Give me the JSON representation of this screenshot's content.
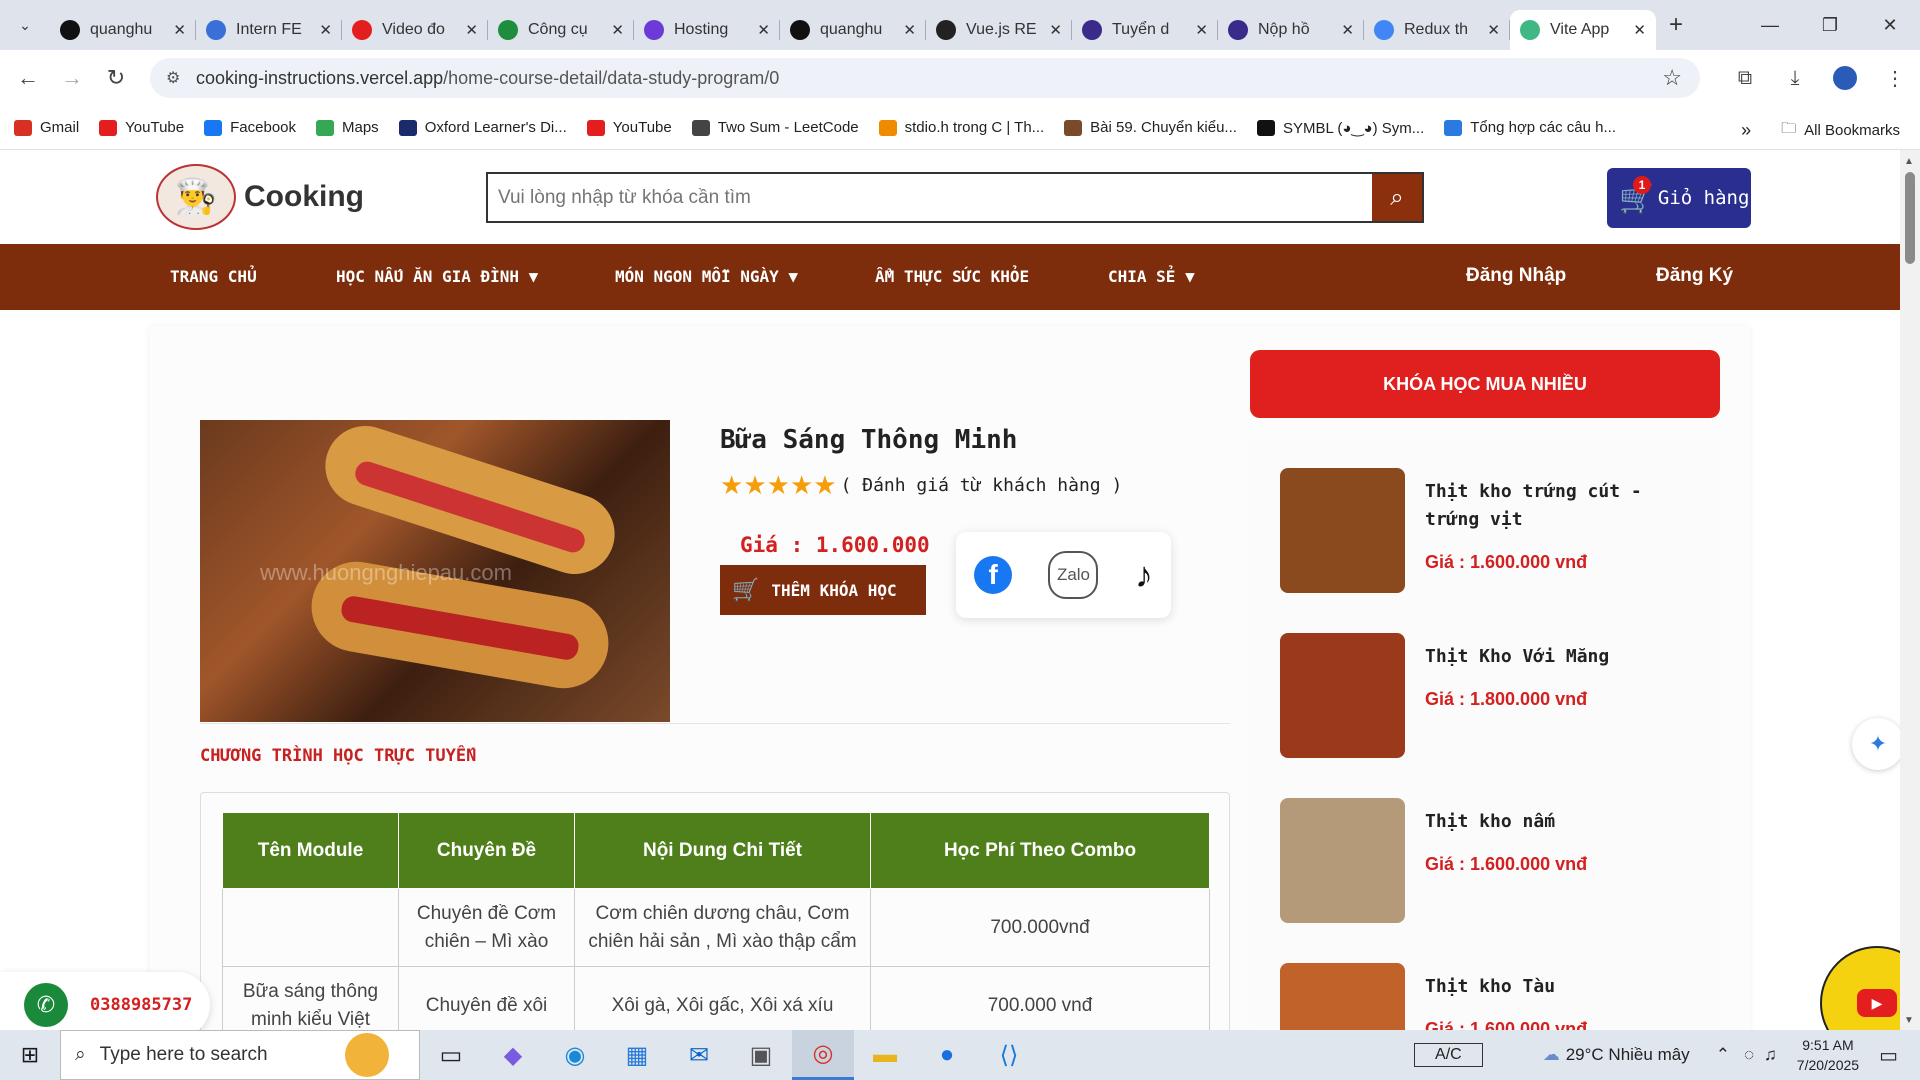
{
  "browser": {
    "tabs": [
      {
        "title": "quanghu",
        "icon": "github-icon",
        "color": "#111111"
      },
      {
        "title": "Intern FE",
        "icon": "docs-icon",
        "color": "#3b6fd8"
      },
      {
        "title": "Video đo",
        "icon": "youtube-icon",
        "color": "#e41e1e"
      },
      {
        "title": "Công cụ",
        "icon": "sheets-icon",
        "color": "#1e8e3e"
      },
      {
        "title": "Hosting",
        "icon": "hosting-icon",
        "color": "#6b3ad8"
      },
      {
        "title": "quanghu",
        "icon": "github-icon",
        "color": "#111111"
      },
      {
        "title": "Vue.js RE",
        "icon": "openai-icon",
        "color": "#222222"
      },
      {
        "title": "Tuyển d",
        "icon": "c-icon",
        "color": "#3a2a8a"
      },
      {
        "title": "Nộp hồ",
        "icon": "c-icon",
        "color": "#3a2a8a"
      },
      {
        "title": "Redux th",
        "icon": "google-icon",
        "color": "#4285f4"
      },
      {
        "title": "Vite App",
        "icon": "vue-icon",
        "color": "#41b883"
      }
    ],
    "url_host": "cooking-instructions.vercel.app",
    "url_path": "/home-course-detail/data-study-program/0",
    "bookmarks": [
      {
        "label": "Gmail",
        "color": "#d93025"
      },
      {
        "label": "YouTube",
        "color": "#e41e1e"
      },
      {
        "label": "Facebook",
        "color": "#1877f2"
      },
      {
        "label": "Maps",
        "color": "#34a853"
      },
      {
        "label": "Oxford Learner's Di...",
        "color": "#1b2a6b"
      },
      {
        "label": "YouTube",
        "color": "#e41e1e"
      },
      {
        "label": "Two Sum - LeetCode",
        "color": "#444444"
      },
      {
        "label": "stdio.h trong C | Th...",
        "color": "#f08a00"
      },
      {
        "label": "Bài 59. Chuyển kiểu...",
        "color": "#7a4a2a"
      },
      {
        "label": "SYMBL (◕‿◕) Sym...",
        "color": "#111111"
      },
      {
        "label": "Tổng hợp các câu h...",
        "color": "#2a7ae2"
      }
    ],
    "all_bookmarks": "All Bookmarks"
  },
  "site": {
    "brand": "Cooking",
    "search_placeholder": "Vui lòng nhập từ khóa cần tìm",
    "cart_label": "Giỏ hàng",
    "cart_count": "1",
    "menu": [
      "TRANG CHỦ",
      "HỌC NẤU ĂN GIA ĐÌNH ▼",
      "MÓN NGON MỖI NGÀY ▼",
      "ẨM THỰC SỨC KHỎE",
      "CHIA SẺ ▼"
    ],
    "login": "Đăng Nhập",
    "register": "Đăng Ký"
  },
  "product": {
    "title": "Bữa Sáng Thông Minh",
    "rating_text": "( Đánh giá từ khách hàng )",
    "stars": 5,
    "price": "Giá : 1.600.000",
    "add_button": "THÊM KHÓA HỌC",
    "watermark": "www.huongnghiepau.com",
    "share": {
      "zalo": "Zalo"
    }
  },
  "program": {
    "section_title": "CHƯƠNG TRÌNH HỌC TRỰC TUYẾN",
    "headers": [
      "Tên Module",
      "Chuyên Đề",
      "Nội Dung Chi Tiết",
      "Học Phí Theo Combo"
    ],
    "rows": [
      [
        "",
        "Chuyên đề Cơm chiên – Mì xào",
        "Cơm chiên dương châu, Cơm chiên hải sản , Mì xào thập cẩm",
        "700.000vnđ"
      ],
      [
        "Bữa sáng thông minh kiểu Việt",
        "Chuyên đề xôi",
        "Xôi gà, Xôi gấc, Xôi xá xíu",
        "700.000 vnđ"
      ]
    ]
  },
  "sidebar": {
    "heading": "KHÓA HỌC MUA NHIỀU",
    "items": [
      {
        "name": "Thịt kho trứng cút - trứng vịt",
        "price": "Giá : 1.600.000 vnđ",
        "color": "#8a4a1e"
      },
      {
        "name": "Thịt Kho Với Măng",
        "price": "Giá : 1.800.000 vnđ",
        "color": "#9a3a1a"
      },
      {
        "name": "Thịt kho nấm",
        "price": "Giá : 1.600.000 vnđ",
        "color": "#b49a78"
      },
      {
        "name": "Thịt kho Tàu",
        "price": "Giá : 1.600.000 vnđ",
        "color": "#c0622a"
      }
    ]
  },
  "floating": {
    "phone": "0388985737"
  },
  "taskbar": {
    "search_placeholder": "Type here to search",
    "ac_label": "A/C",
    "weather": "29°C  Nhiều mây",
    "time": "9:51 AM",
    "date": "7/20/2025"
  }
}
